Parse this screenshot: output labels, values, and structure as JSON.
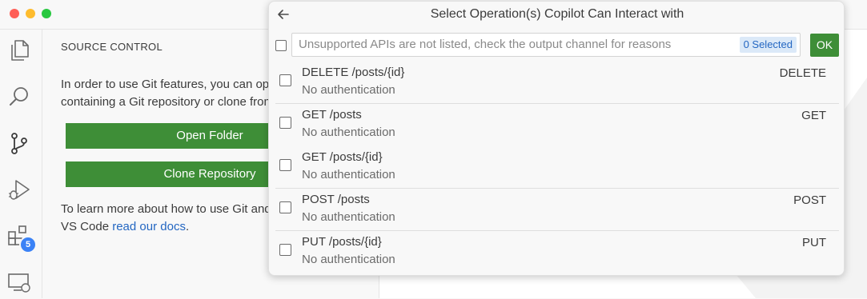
{
  "window": {
    "traffic_lights": [
      "close",
      "minimize",
      "maximize"
    ]
  },
  "activity_bar": {
    "icons": [
      "files-icon",
      "search-icon",
      "source-control-icon",
      "run-debug-icon",
      "extensions-icon",
      "remote-explorer-icon"
    ],
    "extensions_badge": "5"
  },
  "sidebar": {
    "title": "SOURCE CONTROL",
    "intro_text": "In order to use Git features, you can open a folder containing a Git repository or clone from a URL.",
    "open_folder_label": "Open Folder",
    "clone_repository_label": "Clone Repository",
    "learn_more_text": "To learn more about how to use Git and source control in VS Code ",
    "learn_more_link": "read our docs",
    "learn_more_suffix": "."
  },
  "quick_pick": {
    "title": "Select Operation(s) Copilot Can Interact with",
    "placeholder": "Unsupported APIs are not listed, check the output channel for reasons",
    "selected_count": "0 Selected",
    "ok_label": "OK",
    "items": [
      {
        "label": "DELETE /posts/{id}",
        "detail": "No authentication",
        "description": "DELETE",
        "separator": true
      },
      {
        "label": "GET /posts",
        "detail": "No authentication",
        "description": "GET",
        "separator": true
      },
      {
        "label": "GET /posts/{id}",
        "detail": "No authentication",
        "description": "",
        "separator": false
      },
      {
        "label": "POST /posts",
        "detail": "No authentication",
        "description": "POST",
        "separator": true
      },
      {
        "label": "PUT /posts/{id}",
        "detail": "No authentication",
        "description": "PUT",
        "separator": true
      }
    ]
  },
  "colors": {
    "accent_green": "#3e8e37",
    "link_blue": "#2467c2",
    "badge_blue": "#3b82f6"
  }
}
